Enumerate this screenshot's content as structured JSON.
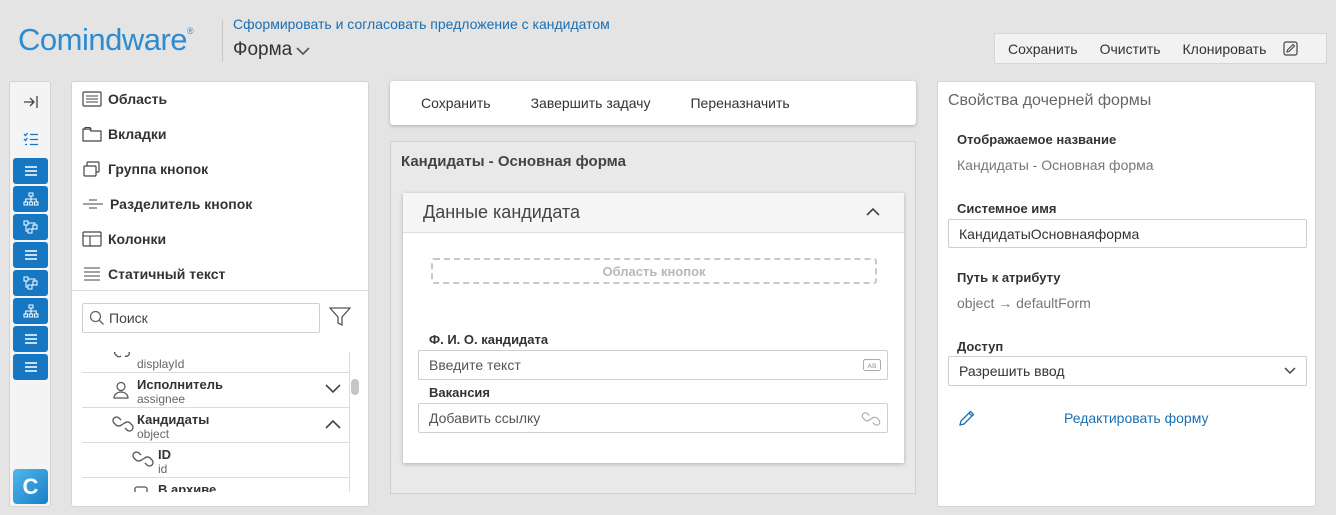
{
  "header": {
    "logo": "Comindware",
    "logo_mark": "®",
    "process_link": "Сформировать и согласовать предложение с кандидатом",
    "form_title": "Форма"
  },
  "top_toolbar": {
    "save": "Сохранить",
    "clear": "Очистить",
    "clone": "Клонировать"
  },
  "strip": {
    "app_letter": "C"
  },
  "components": {
    "items": [
      {
        "label": "Область",
        "icon": "area-icon"
      },
      {
        "label": "Вкладки",
        "icon": "tabs-icon"
      },
      {
        "label": "Группа кнопок",
        "icon": "button-group-icon"
      },
      {
        "label": "Разделитель кнопок",
        "icon": "button-separator-icon"
      },
      {
        "label": "Колонки",
        "icon": "columns-icon"
      },
      {
        "label": "Статичный текст",
        "icon": "static-text-icon"
      }
    ],
    "search_placeholder": "Поиск"
  },
  "tree": [
    {
      "label": "",
      "sub": "displayId"
    },
    {
      "label": "Исполнитель",
      "sub": "assignee"
    },
    {
      "label": "Кандидаты",
      "sub": "object"
    },
    {
      "label": "ID",
      "sub": "id"
    },
    {
      "label": "В архиве",
      "sub": ""
    }
  ],
  "form_toolbar": {
    "save": "Сохранить",
    "complete": "Завершить задачу",
    "reassign": "Переназначить"
  },
  "canvas": {
    "title": "Кандидаты - Основная форма",
    "card_title": "Данные кандидата",
    "button_area": "Область кнопок",
    "fields": [
      {
        "label": "Ф. И. О. кандидата",
        "placeholder": "Введите текст",
        "badge": "AB"
      },
      {
        "label": "Вакансия",
        "placeholder": "Добавить ссылку"
      }
    ]
  },
  "properties": {
    "title": "Свойства дочерней формы",
    "display_name_label": "Отображаемое название",
    "display_name_value": "Кандидаты - Основная форма",
    "system_name_label": "Системное имя",
    "system_name_value": "КандидатыОсновнаяформа",
    "path_label": "Путь к атрибуту",
    "path_value": "object → defaultForm",
    "access_label": "Доступ",
    "access_value": "Разрешить ввод",
    "edit_form": "Редактировать форму"
  },
  "colors": {
    "accent": "#1678c2",
    "link": "#1b6fb3",
    "logo": "#2e8bd0"
  }
}
